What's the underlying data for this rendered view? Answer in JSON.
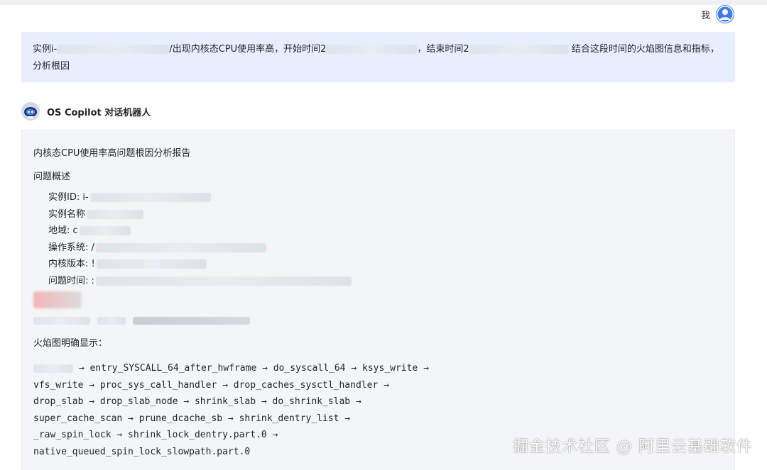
{
  "user": {
    "name": "我"
  },
  "question": {
    "part1": "实例i-",
    "part2": "/出现内核态CPU使用率高，开始时间2",
    "part3": "，结束时间2",
    "part4": "结合这段时间的火焰图信息和指标，分析根因"
  },
  "bot": {
    "name": "OS Copilot 对话机器人"
  },
  "answer": {
    "title": "内核态CPU使用率高问题根因分析报告",
    "overview_heading": "问题概述",
    "info": [
      {
        "label": "实例ID: i-"
      },
      {
        "label": "实例名称"
      },
      {
        "label": "地域: c"
      },
      {
        "label": "操作系统: /"
      },
      {
        "label": "内核版本: !"
      },
      {
        "label": "问题时间: :"
      }
    ],
    "flame_label": "火焰图明确显示：",
    "call_chain": [
      " → entry_SYSCALL_64_after_hwframe → do_syscall_64 → ksys_write →",
      "vfs_write → proc_sys_call_handler → drop_caches_sysctl_handler →",
      "drop_slab → drop_slab_node → shrink_slab → do_shrink_slab →",
      "super_cache_scan → prune_dcache_sb → shrink_dentry_list →",
      "_raw_spin_lock → shrink_lock_dentry.part.0 →",
      "native_queued_spin_lock_slowpath.part.0"
    ]
  },
  "watermark": "掘金技术社区 @ 阿里云基础软件",
  "colors": {
    "question_bg": "#e7efff",
    "answer_bg": "#f4f5f7",
    "avatar": "#3f7df3"
  }
}
